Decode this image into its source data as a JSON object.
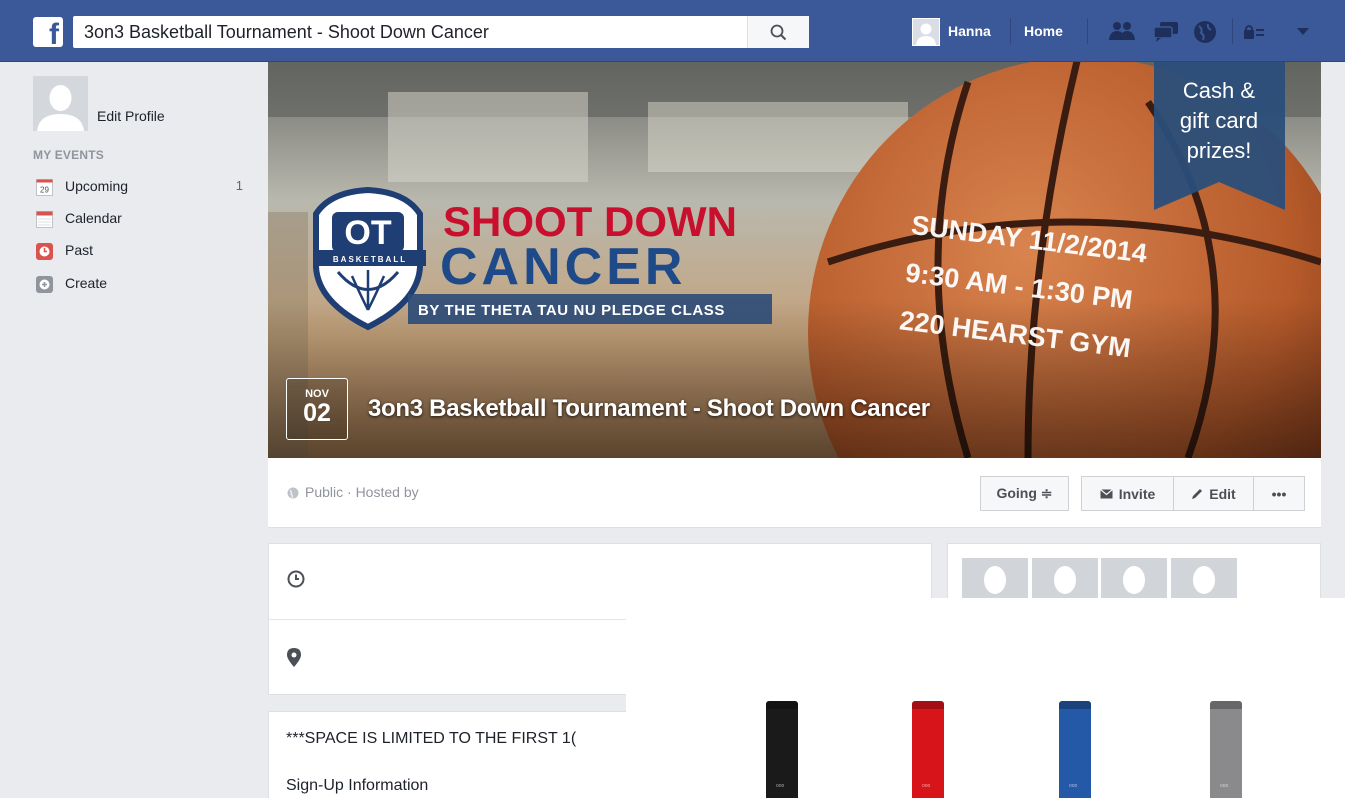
{
  "topbar": {
    "logo_letter": "f",
    "search_value": "3on3 Basketball Tournament - Shoot Down Cancer",
    "user_name": "Hanna",
    "home_label": "Home"
  },
  "sidebar": {
    "edit_profile": "Edit Profile",
    "section_title": "MY EVENTS",
    "items": [
      {
        "label": "Upcoming",
        "count": "1",
        "icon": "calendar-day-icon",
        "icon_text": "29"
      },
      {
        "label": "Calendar",
        "count": "",
        "icon": "calendar-icon"
      },
      {
        "label": "Past",
        "count": "",
        "icon": "clock-icon"
      },
      {
        "label": "Create",
        "count": "",
        "icon": "plus-icon"
      }
    ]
  },
  "cover": {
    "logo_letters": "OT",
    "logo_sub": "BASKETBALL",
    "headline_1": "SHOOT DOWN",
    "headline_2": "CANCER",
    "byline": "BY THE THETA TAU NU PLEDGE CLASS",
    "when_1": "SUNDAY 11/2/2014",
    "when_2": "9:30 AM - 1:30 PM",
    "where": "220 HEARST GYM",
    "banner_1": "Cash &",
    "banner_2": "gift card",
    "banner_3": "prizes!",
    "date_month": "NOV",
    "date_day": "02",
    "title": "3on3 Basketball Tournament - Shoot Down Cancer"
  },
  "action_bar": {
    "privacy": "Public · Hosted by",
    "going": "Going ≑",
    "invite": "Invite",
    "edit": "Edit",
    "more": "•••"
  },
  "details": {
    "line_1": "***SPACE IS LIMITED TO THE FIRST 1(",
    "line_2": "Sign-Up Information"
  },
  "overlay": {
    "bottle_colors": [
      "#1a1a1a",
      "#d8141b",
      "#2359a6",
      "#8a8a8c"
    ],
    "bottle_mark": "ooo"
  },
  "colors": {
    "facebook_blue": "#3b5998",
    "headline_red": "#c8102e",
    "headline_blue": "#1f4a8a"
  }
}
